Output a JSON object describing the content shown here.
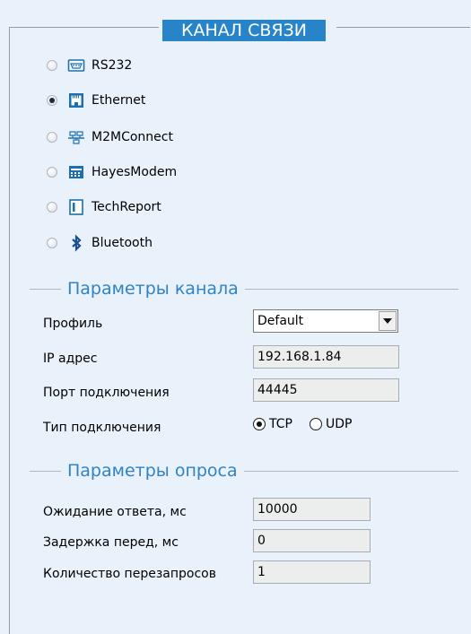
{
  "title": "КАНАЛ СВЯЗИ",
  "channels": [
    {
      "label": "RS232",
      "icon": "serial-port-icon",
      "selected": false
    },
    {
      "label": "Ethernet",
      "icon": "ethernet-port-icon",
      "selected": true
    },
    {
      "label": "M2MConnect",
      "icon": "network-switch-icon",
      "selected": false
    },
    {
      "label": "HayesModem",
      "icon": "modem-icon",
      "selected": false
    },
    {
      "label": "TechReport",
      "icon": "document-icon",
      "selected": false
    },
    {
      "label": "Bluetooth",
      "icon": "bluetooth-icon",
      "selected": false
    }
  ],
  "channel_params": {
    "title": "Параметры канала",
    "profile_label": "Профиль",
    "profile_value": "Default",
    "ip_label": "IP адрес",
    "ip_value": "192.168.1.84",
    "port_label": "Порт подключения",
    "port_value": "44445",
    "conn_type_label": "Тип подключения",
    "conn_options": [
      {
        "label": "TCP",
        "selected": true
      },
      {
        "label": "UDP",
        "selected": false
      }
    ]
  },
  "poll_params": {
    "title": "Параметры опроса",
    "wait_label": "Ожидание ответа, мс",
    "wait_value": "10000",
    "delay_label": "Задержка перед, мс",
    "delay_value": "0",
    "retries_label": "Количество перезапросов",
    "retries_value": "1"
  },
  "colors": {
    "background": "#e9f1fb",
    "title_bg": "#2784c9",
    "section_title": "#2f83c6"
  }
}
